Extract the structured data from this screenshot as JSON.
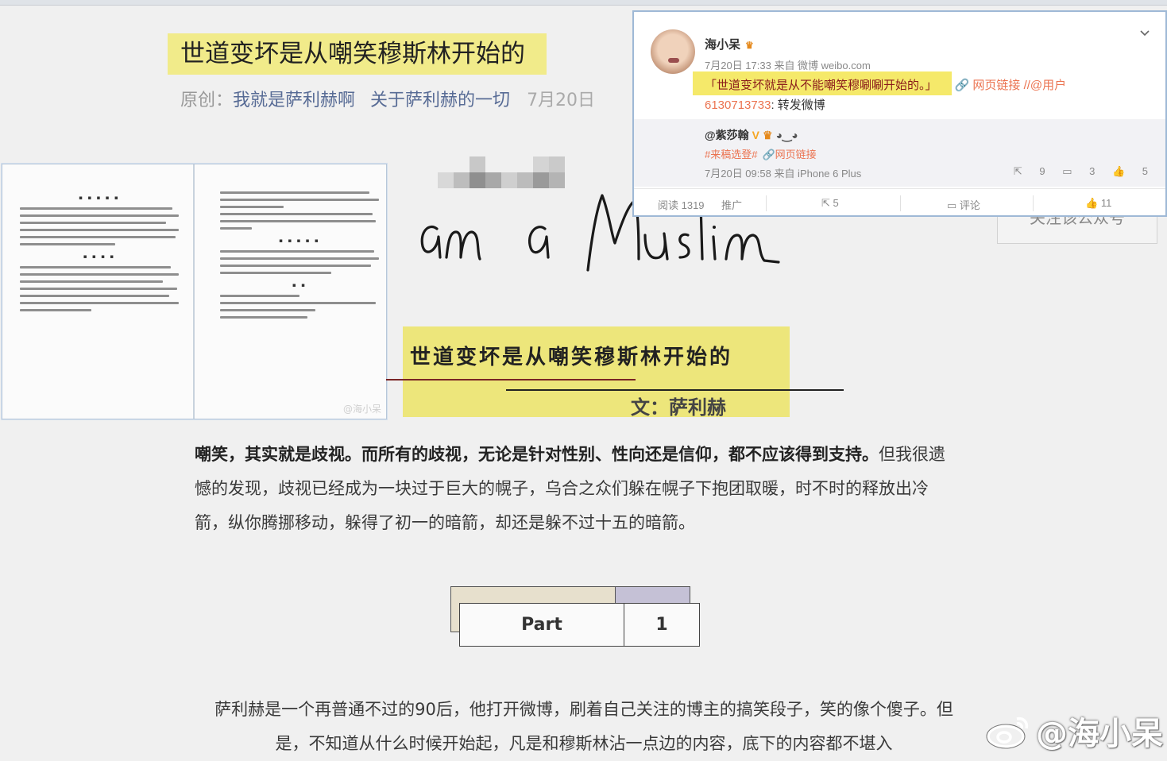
{
  "article": {
    "title": "世道变坏是从嘲笑穆斯林开始的",
    "original_label": "原创",
    "colon": "：",
    "author": "我就是萨利赫啊",
    "account": "关于萨利赫的一切",
    "date": "7月20日"
  },
  "image_overlay": {
    "banner_title": "世道变坏是从嘲笑穆斯林开始的",
    "banner_author": "文：萨利赫",
    "book_watermark": "@海小呆",
    "follow_text": "关注该公众号"
  },
  "body": {
    "para1_bold": "嘲笑，其实就是歧视。而所有的歧视，无论是针对性别、性向还是信仰，都不应该得到支持。",
    "para1_rest": "但我很遗憾的发现，歧视已经成为一块过于巨大的幌子，乌合之众们躲在幌子下抱团取暖，时不时的释放出冷箭，纵你腾挪移动，躲得了初一的暗箭，却还是躲不过十五的暗箭。",
    "part_label": "Part",
    "part_number": "1",
    "para2": "萨利赫是一个再普通不过的90后，他打开微博，刷着自己关注的博主的搞笑段子，笑的像个傻子。但是，不知道从什么时候开始起，凡是和穆斯林沾一点边的内容，底下的内容都不堪入"
  },
  "weibo": {
    "username": "海小呆",
    "time": "7月20日 17:33 来自 微博 weibo.com",
    "post_text": "「世道变坏就是从不能嘲笑穆唰唰开始的。」",
    "link_text": "网页链接",
    "at_user": "//@用户",
    "uid": "6130713733",
    "uid_suffix": ": 转发微博",
    "forward": {
      "name": "@紫莎翰",
      "tag": "#来稿选登#",
      "link": "网页链接",
      "time": "7月20日 09:58 来自 iPhone 6 Plus",
      "reposts": "9",
      "comments": "3",
      "likes": "5"
    },
    "actions": {
      "reads": "阅读 1319",
      "promote": "推广",
      "reposts": "5",
      "comment": "评论",
      "likes": "11"
    }
  },
  "watermark": {
    "text": "@海小呆"
  },
  "colors": {
    "highlight_yellow": "#f1eb8a",
    "banner_yellow": "#ede67b",
    "link_blue": "#576b95",
    "weibo_orange": "#eb7350"
  }
}
